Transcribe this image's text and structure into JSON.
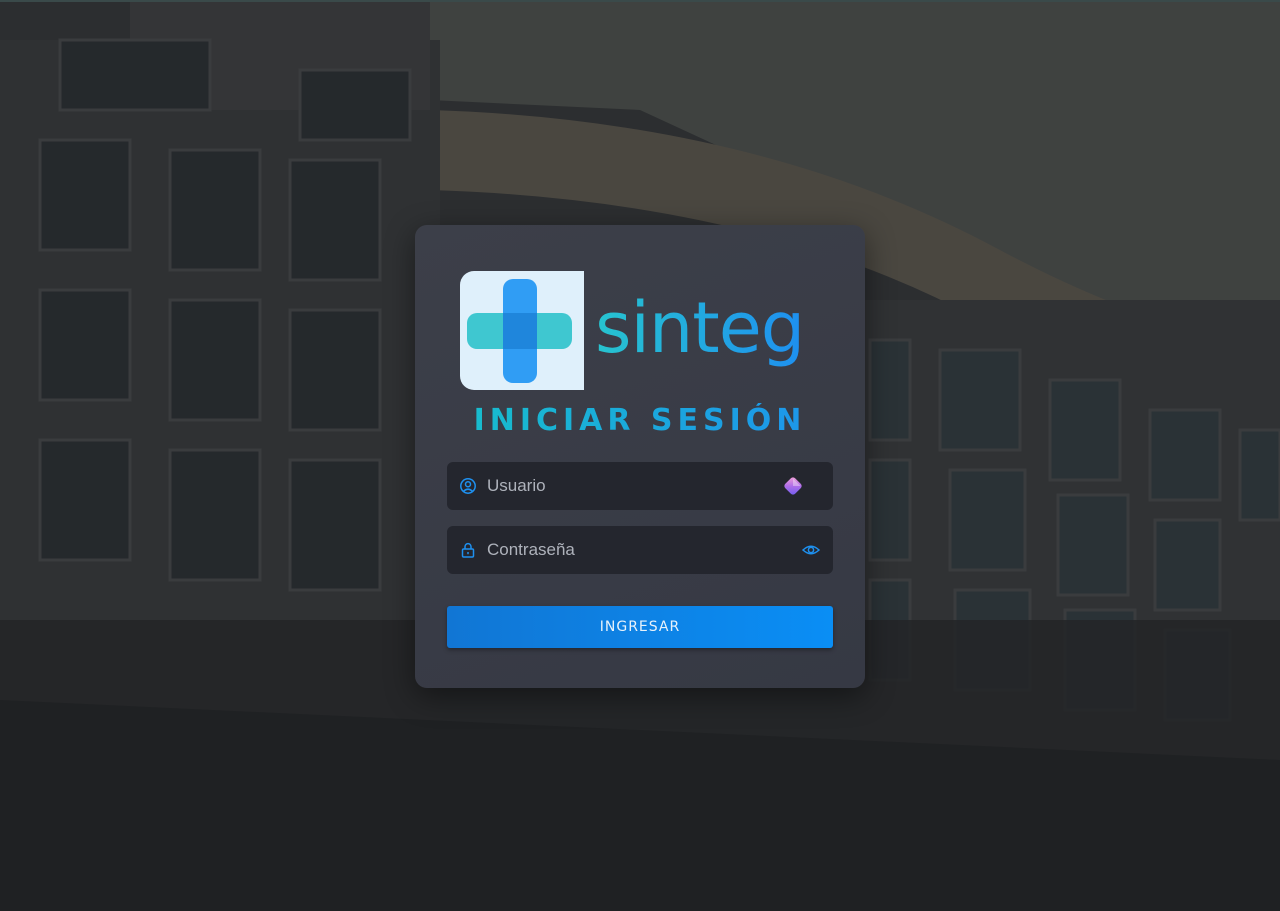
{
  "brand": {
    "name": "sinteg",
    "accent_teal": "#27c4cf",
    "accent_blue": "#1e8ff0"
  },
  "login": {
    "title": "INICIAR SESIÓN",
    "username": {
      "placeholder": "Usuario",
      "value": "",
      "icon": "user-circle-icon",
      "extension_icon": "password-manager-icon"
    },
    "password": {
      "placeholder": "Contraseña",
      "value": "",
      "icon": "lock-icon",
      "toggle_icon": "eye-icon"
    },
    "submit_label": "INGRESAR"
  },
  "background": {
    "description_icon": "building-photo"
  }
}
